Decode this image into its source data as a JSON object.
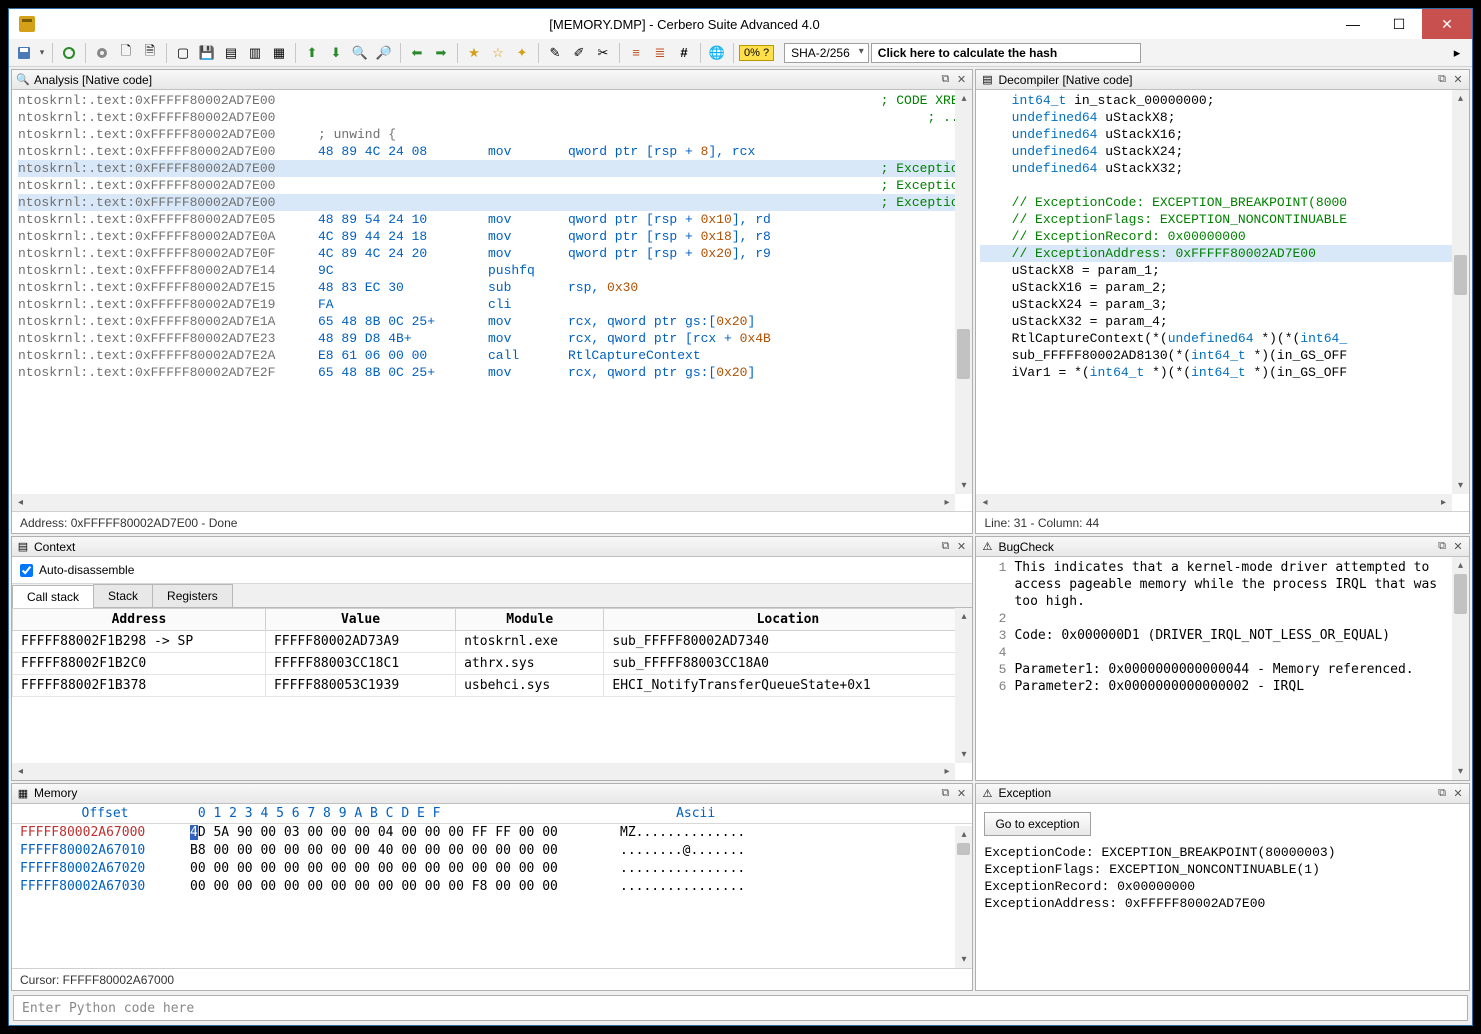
{
  "window": {
    "title": "[MEMORY.DMP] - Cerbero Suite Advanced 4.0"
  },
  "toolbar": {
    "percent": "0% ?",
    "hash_algo": "SHA-2/256",
    "hash_field": "Click here to calculate the hash"
  },
  "analysis": {
    "title": "Analysis [Native code]",
    "status": "Address: 0xFFFFF80002AD7E00 - Done",
    "lines": [
      {
        "loc": "ntoskrnl:.text:0xFFFFF80002AD7E00",
        "bytes": "",
        "mn": "",
        "op": "",
        "cmt": "; CODE XREF"
      },
      {
        "loc": "ntoskrnl:.text:0xFFFFF80002AD7E00",
        "bytes": "",
        "mn": "",
        "op": "",
        "cmt": "; ..."
      },
      {
        "loc": "ntoskrnl:.text:0xFFFFF80002AD7E00",
        "bytes": "",
        "mn": "",
        "op": "",
        "pre": "; unwind {"
      },
      {
        "loc": "ntoskrnl:.text:0xFFFFF80002AD7E00",
        "bytes": "48 89 4C 24 08",
        "mn": "mov",
        "op": "qword ptr [rsp + |8|], rcx",
        "cmt": ";"
      },
      {
        "loc": "ntoskrnl:.text:0xFFFFF80002AD7E00",
        "bytes": "",
        "mn": "",
        "op": "",
        "cmt": "; Exception",
        "hl": true
      },
      {
        "loc": "ntoskrnl:.text:0xFFFFF80002AD7E00",
        "bytes": "",
        "mn": "",
        "op": "",
        "cmt": "; Exception"
      },
      {
        "loc": "ntoskrnl:.text:0xFFFFF80002AD7E00",
        "bytes": "",
        "mn": "",
        "op": "",
        "cmt": "; Exception",
        "hl": true
      },
      {
        "loc": "ntoskrnl:.text:0xFFFFF80002AD7E05",
        "bytes": "48 89 54 24 10",
        "mn": "mov",
        "op": "qword ptr [rsp + |0x10|], rd"
      },
      {
        "loc": "ntoskrnl:.text:0xFFFFF80002AD7E0A",
        "bytes": "4C 89 44 24 18",
        "mn": "mov",
        "op": "qword ptr [rsp + |0x18|], r8"
      },
      {
        "loc": "ntoskrnl:.text:0xFFFFF80002AD7E0F",
        "bytes": "4C 89 4C 24 20",
        "mn": "mov",
        "op": "qword ptr [rsp + |0x20|], r9"
      },
      {
        "loc": "ntoskrnl:.text:0xFFFFF80002AD7E14",
        "bytes": "9C",
        "mn": "pushfq",
        "op": ""
      },
      {
        "loc": "ntoskrnl:.text:0xFFFFF80002AD7E15",
        "bytes": "48 83 EC 30",
        "mn": "sub",
        "op": "rsp, |0x30|"
      },
      {
        "loc": "ntoskrnl:.text:0xFFFFF80002AD7E19",
        "bytes": "FA",
        "mn": "cli",
        "op": ""
      },
      {
        "loc": "ntoskrnl:.text:0xFFFFF80002AD7E1A",
        "bytes": "65 48 8B 0C 25+",
        "mn": "mov",
        "op": "rcx, qword ptr gs:[|0x20|]"
      },
      {
        "loc": "ntoskrnl:.text:0xFFFFF80002AD7E23",
        "bytes": "48 89 D8 4B+",
        "mn": "mov",
        "op": "rcx, qword ptr [rcx + |0x4B|"
      },
      {
        "loc": "ntoskrnl:.text:0xFFFFF80002AD7E2A",
        "bytes": "E8 61 06 00 00",
        "mn": "call",
        "op": "RtlCaptureContext"
      },
      {
        "loc": "ntoskrnl:.text:0xFFFFF80002AD7E2F",
        "bytes": "65 48 8B 0C 25+",
        "mn": "mov",
        "op": "rcx, qword ptr gs:[|0x20|]"
      }
    ]
  },
  "decompiler": {
    "title": "Decompiler [Native code]",
    "status": "Line: 31 - Column: 44",
    "lines": [
      {
        "t": "    int64_t in_stack_00000000;",
        "kw": [
          "int64_t"
        ]
      },
      {
        "t": "    undefined64 uStackX8;",
        "kw": [
          "undefined64"
        ]
      },
      {
        "t": "    undefined64 uStackX16;",
        "kw": [
          "undefined64"
        ]
      },
      {
        "t": "    undefined64 uStackX24;",
        "kw": [
          "undefined64"
        ]
      },
      {
        "t": "    undefined64 uStackX32;",
        "kw": [
          "undefined64"
        ]
      },
      {
        "t": "    "
      },
      {
        "t": "    // ExceptionCode: EXCEPTION_BREAKPOINT(8000",
        "cm": true
      },
      {
        "t": "    // ExceptionFlags: EXCEPTION_NONCONTINUABLE",
        "cm": true
      },
      {
        "t": "    // ExceptionRecord: 0x00000000",
        "cm": true
      },
      {
        "t": "    // ExceptionAddress: 0xFFFFF80002AD7E00",
        "cm": true,
        "hl": true
      },
      {
        "t": "    uStackX8 = param_1;"
      },
      {
        "t": "    uStackX16 = param_2;"
      },
      {
        "t": "    uStackX24 = param_3;"
      },
      {
        "t": "    uStackX32 = param_4;"
      },
      {
        "t": "    RtlCaptureContext(*(undefined64 *)(*(int64_",
        "kw": [
          "undefined64",
          "int64_"
        ]
      },
      {
        "t": "    sub_FFFFF80002AD8130(*(int64_t *)(in_GS_OFF",
        "kw": [
          "int64_t"
        ]
      },
      {
        "t": "    iVar1 = *(int64_t *)(*(int64_t *)(in_GS_OFF",
        "kw": [
          "int64_t"
        ]
      }
    ]
  },
  "context": {
    "title": "Context",
    "auto": "Auto-disassemble",
    "tabs": [
      "Call stack",
      "Stack",
      "Registers"
    ],
    "cols": [
      "Address",
      "Value",
      "Module",
      "Location"
    ],
    "rows": [
      [
        "FFFFF88002F1B298 -> SP",
        "FFFFF80002AD73A9",
        "ntoskrnl.exe",
        "sub_FFFFF80002AD7340"
      ],
      [
        "FFFFF88002F1B2C0",
        "FFFFF88003CC18C1",
        "athrx.sys",
        "sub_FFFFF88003CC18A0"
      ],
      [
        "FFFFF88002F1B378",
        "FFFFF880053C1939",
        "usbehci.sys",
        "EHCI_NotifyTransferQueueState+0x1"
      ]
    ]
  },
  "bugcheck": {
    "title": "BugCheck",
    "lines": [
      {
        "n": "1",
        "t": "This indicates that a kernel-mode driver attempted to access pageable memory while the process IRQL that was too high."
      },
      {
        "n": "2",
        "t": ""
      },
      {
        "n": "3",
        "t": "Code: 0x000000D1 (DRIVER_IRQL_NOT_LESS_OR_EQUAL)"
      },
      {
        "n": "4",
        "t": ""
      },
      {
        "n": "5",
        "t": "Parameter1: 0x0000000000000044 - Memory referenced."
      },
      {
        "n": "6",
        "t": "Parameter2: 0x0000000000000002 - IRQL"
      }
    ]
  },
  "memory": {
    "title": "Memory",
    "hdr_offset": "Offset",
    "hdr_hex": "0  1  2  3  4  5  6  7   8  9  A  B  C  D  E  F",
    "hdr_asc": "Ascii",
    "rows": [
      {
        "off": "FFFFF80002A67000",
        "red": true,
        "hex": "4D 5A 90 00 03 00 00 00  04 00 00 00 FF FF 00 00",
        "asc": "MZ..............",
        "cur": 0
      },
      {
        "off": "FFFFF80002A67010",
        "hex": "B8 00 00 00 00 00 00 00  40 00 00 00 00 00 00 00",
        "asc": "........@......."
      },
      {
        "off": "FFFFF80002A67020",
        "hex": "00 00 00 00 00 00 00 00  00 00 00 00 00 00 00 00",
        "asc": "................"
      },
      {
        "off": "FFFFF80002A67030",
        "hex": "00 00 00 00 00 00 00 00  00 00 00 00 F8 00 00 00",
        "asc": "................"
      }
    ],
    "status": "Cursor: FFFFF80002A67000"
  },
  "exception": {
    "title": "Exception",
    "button": "Go to exception",
    "lines": [
      "ExceptionCode: EXCEPTION_BREAKPOINT(80000003)",
      "ExceptionFlags: EXCEPTION_NONCONTINUABLE(1)",
      "ExceptionRecord: 0x00000000",
      "ExceptionAddress: 0xFFFFF80002AD7E00"
    ]
  },
  "cmd": {
    "placeholder": "Enter Python code here"
  }
}
